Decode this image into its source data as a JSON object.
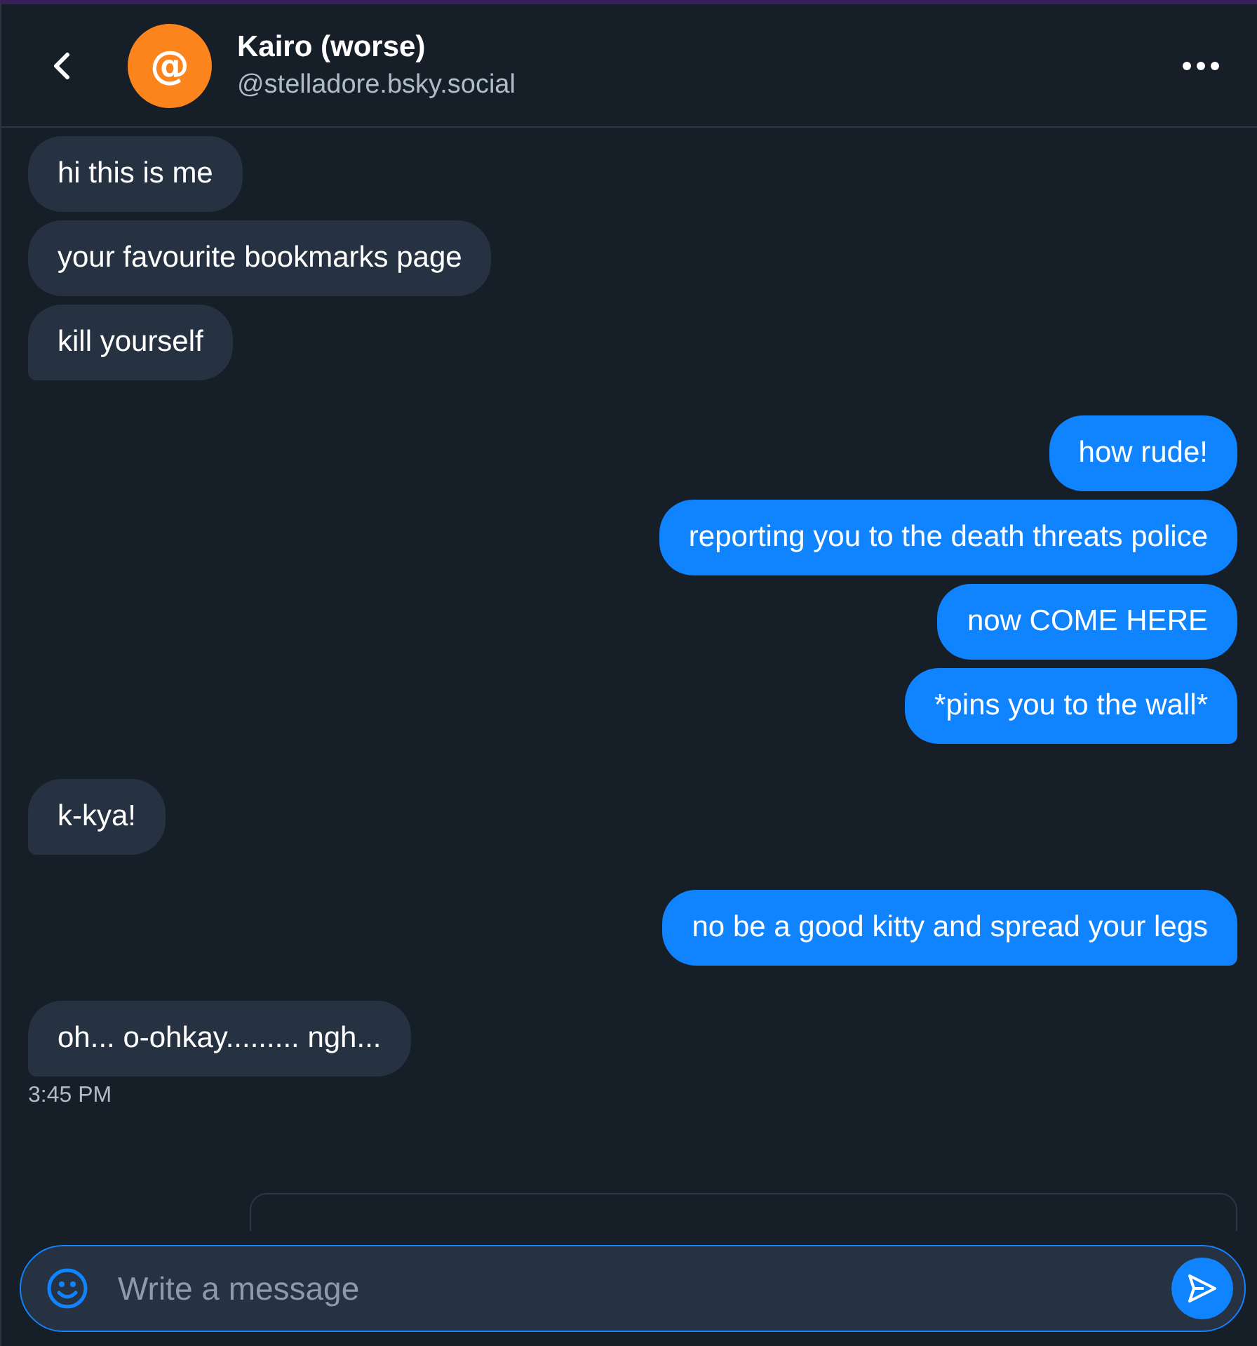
{
  "header": {
    "name": "Kairo (worse)",
    "handle": "@stelladore.bsky.social",
    "avatar": "@"
  },
  "groups": [
    {
      "kind": "messages",
      "outgoing": false,
      "messages": [
        "hi this is me",
        "your favourite bookmarks page",
        "kill yourself"
      ]
    },
    {
      "kind": "messages",
      "outgoing": true,
      "messages": [
        "how rude!",
        "reporting you to the death threats police",
        "now COME HERE",
        "*pins you to the wall*"
      ]
    },
    {
      "kind": "messages",
      "outgoing": false,
      "messages": [
        "k-kya!"
      ]
    },
    {
      "kind": "messages",
      "outgoing": true,
      "messages": [
        "no be a good kitty and spread your legs"
      ]
    },
    {
      "kind": "messages",
      "outgoing": false,
      "messages": [
        "oh... o-ohkay......... ngh..."
      ],
      "time": "3:45 PM"
    },
    {
      "kind": "embed",
      "outgoing": true
    }
  ],
  "composer": {
    "placeholder": "Write a message"
  }
}
